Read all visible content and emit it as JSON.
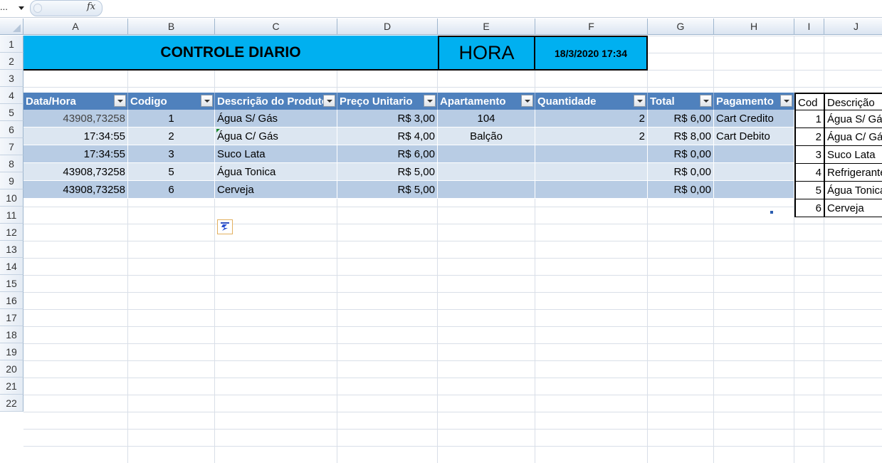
{
  "formula_bar": {
    "name_box": "...",
    "fx_label": "fx"
  },
  "columns": [
    "A",
    "B",
    "C",
    "D",
    "E",
    "F",
    "G",
    "H",
    "I",
    "J"
  ],
  "rows": [
    "1",
    "2",
    "3",
    "4",
    "5",
    "6",
    "7",
    "8",
    "9",
    "10",
    "11",
    "12",
    "13",
    "14",
    "15",
    "16",
    "17",
    "18",
    "19",
    "20",
    "21",
    "22"
  ],
  "title": "CONTROLE DIARIO",
  "hora_label": "HORA",
  "hora_value": "18/3/2020 17:34",
  "table": {
    "headers": [
      "Data/Hora",
      "Codigo",
      "Descrição do Produto",
      "Preço Unitario",
      "Apartamento",
      "Quantidade",
      "Total",
      "Pagamento"
    ],
    "rows": [
      [
        "43908,73258",
        "1",
        "Água S/ Gás",
        "R$ 3,00",
        "104",
        "2",
        "R$ 6,00",
        "Cart Credito"
      ],
      [
        "17:34:55",
        "2",
        "Água C/ Gás",
        "R$ 4,00",
        "Balção",
        "2",
        "R$ 8,00",
        "Cart Debito"
      ],
      [
        "17:34:55",
        "3",
        "Suco Lata",
        "R$ 6,00",
        "",
        "",
        "R$ 0,00",
        ""
      ],
      [
        "43908,73258",
        "5",
        "Água Tonica",
        "R$ 5,00",
        "",
        "",
        "R$ 0,00",
        ""
      ],
      [
        "43908,73258",
        "6",
        "Cerveja",
        "R$ 5,00",
        "",
        "",
        "R$ 0,00",
        ""
      ]
    ]
  },
  "lookup": {
    "headers": [
      "Cod",
      "Descrição"
    ],
    "rows": [
      [
        "1",
        "Água S/ Gás"
      ],
      [
        "2",
        "Água C/ Gás"
      ],
      [
        "3",
        "Suco Lata"
      ],
      [
        "4",
        "Refrigerante"
      ],
      [
        "5",
        "Água Tonica"
      ],
      [
        "6",
        "Cerveja"
      ]
    ]
  },
  "icons": {
    "paste_options": "paste-options-icon",
    "filter": "filter-dropdown-icon"
  }
}
